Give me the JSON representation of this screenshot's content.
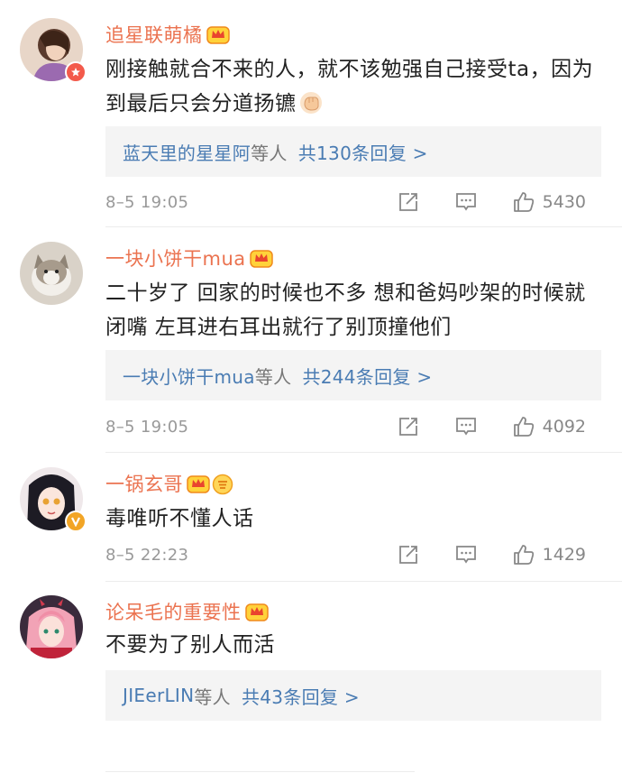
{
  "comments": [
    {
      "username": "追星联萌橘",
      "text": "刚接触就合不来的人，就不该勉强自己接受ta，因为到最后只会分道扬镳",
      "emoji": "fist-emoji",
      "replies": {
        "users": "蓝天里的星星阿",
        "mid": "等人",
        "count": "共130条回复 >"
      },
      "time": "8–5 19:05",
      "likes": "5430"
    },
    {
      "username": "一块小饼干mua",
      "text": "二十岁了 回家的时候也不多 想和爸妈吵架的时候就闭嘴 左耳进右耳出就行了别顶撞他们",
      "replies": {
        "users": "一块小饼干mua",
        "mid": "等人",
        "count": "共244条回复 >"
      },
      "time": "8–5 19:05",
      "likes": "4092"
    },
    {
      "username": "一锅玄哥",
      "text": "毒唯听不懂人话",
      "time": "8–5 22:23",
      "likes": "1429"
    },
    {
      "username": "论呆毛的重要性",
      "text": "不要为了别人而活",
      "replies": {
        "users": "JIEerLIN",
        "mid": "等人",
        "count": "共43条回复 >"
      }
    }
  ],
  "colors": {
    "username": "#eb7350",
    "link": "#4a7cb3",
    "meta": "#999999"
  },
  "icons": [
    "crown-badge-icon",
    "fan-badge-icon",
    "share-icon",
    "comment-icon",
    "like-icon",
    "verified-badge-icon"
  ]
}
